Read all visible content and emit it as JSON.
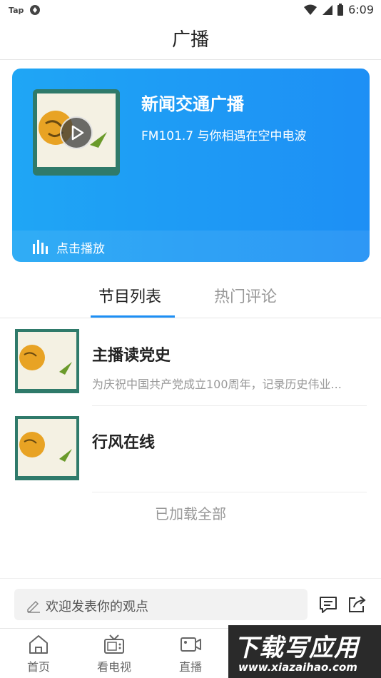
{
  "status_bar": {
    "left_app": "Tap",
    "time": "6:09"
  },
  "header": {
    "title": "广播"
  },
  "station_card": {
    "title": "新闻交通广播",
    "subtitle": "FM101.7 与你相遇在空中电波",
    "play_label": "点击播放",
    "gradient_start": "#1fa6f5",
    "gradient_end": "#1d8ff5"
  },
  "tabs": [
    {
      "label": "节目列表",
      "active": true
    },
    {
      "label": "热门评论",
      "active": false
    }
  ],
  "programs": [
    {
      "title": "主播读党史",
      "description": "为庆祝中国共产党成立100周年，记录历史伟业..."
    },
    {
      "title": "行风在线",
      "description": ""
    }
  ],
  "list_footer": "已加载全部",
  "comment": {
    "placeholder": "欢迎发表你的观点"
  },
  "bottom_nav": [
    {
      "label": "首页",
      "icon": "home-icon"
    },
    {
      "label": "看电视",
      "icon": "tv-icon"
    },
    {
      "label": "直播",
      "icon": "video-icon"
    }
  ],
  "watermark": {
    "title": "下载写应用",
    "url": "www.xiazaihao.com"
  },
  "accent_color": "#1d8ff5"
}
